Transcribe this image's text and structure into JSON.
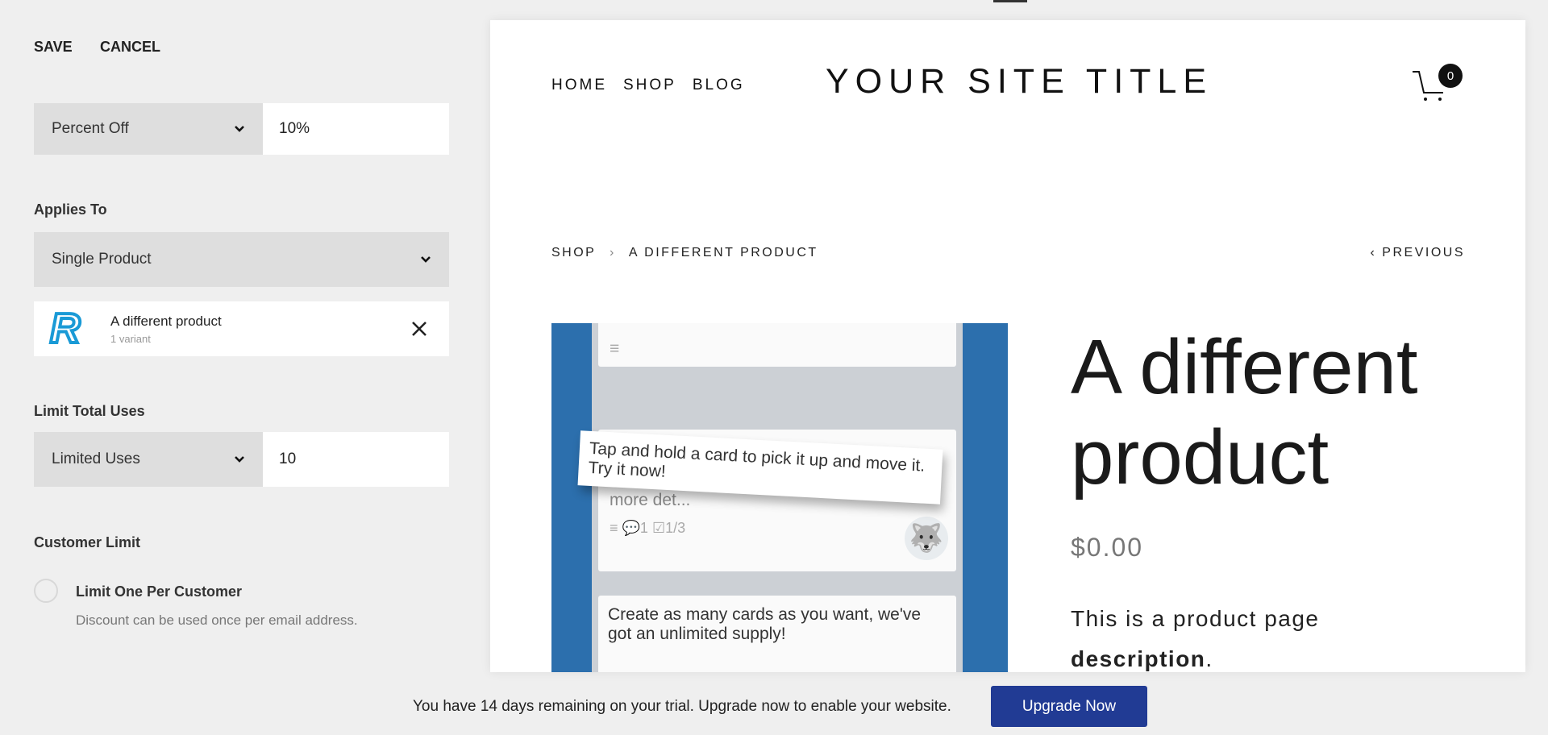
{
  "editor": {
    "save": "SAVE",
    "cancel": "CANCEL",
    "discount_type": "Percent Off",
    "discount_value": "10%",
    "applies_to_label": "Applies To",
    "applies_to": "Single Product",
    "product": {
      "name": "A different product",
      "variants": "1 variant",
      "logo_letter": "R"
    },
    "limit_total_label": "Limit Total Uses",
    "limit_type": "Limited Uses",
    "limit_value": "10",
    "customer_limit_label": "Customer Limit",
    "one_per_customer": "Limit One Per Customer",
    "one_per_customer_desc": "Discount can be used once per email address.",
    "one_per_customer_checked": false
  },
  "site": {
    "nav": [
      "HOME",
      "SHOP",
      "BLOG"
    ],
    "title": "YOUR SITE TITLE",
    "cart_count": "0",
    "breadcrumb": [
      "SHOP",
      "A DIFFERENT PRODUCT"
    ],
    "breadcrumb_sep": "›",
    "previous": "‹ PREVIOUS",
    "product_title": "A different product",
    "price": "$0.00",
    "desc_plain": "This is a product page",
    "desc_bold": "description",
    "desc_end": ".",
    "image": {
      "tooltip": "Tap and hold a card to pick it up and move it. Try it now!",
      "card_hidden": "more det...",
      "comments": "1",
      "checklist": "1/3",
      "card2": "Create as many cards as you want, we've got an unlimited supply!"
    }
  },
  "trial": {
    "message": "You have 14 days remaining on your trial. Upgrade now to enable your website.",
    "button": "Upgrade Now",
    "button_color": "#213b94"
  }
}
